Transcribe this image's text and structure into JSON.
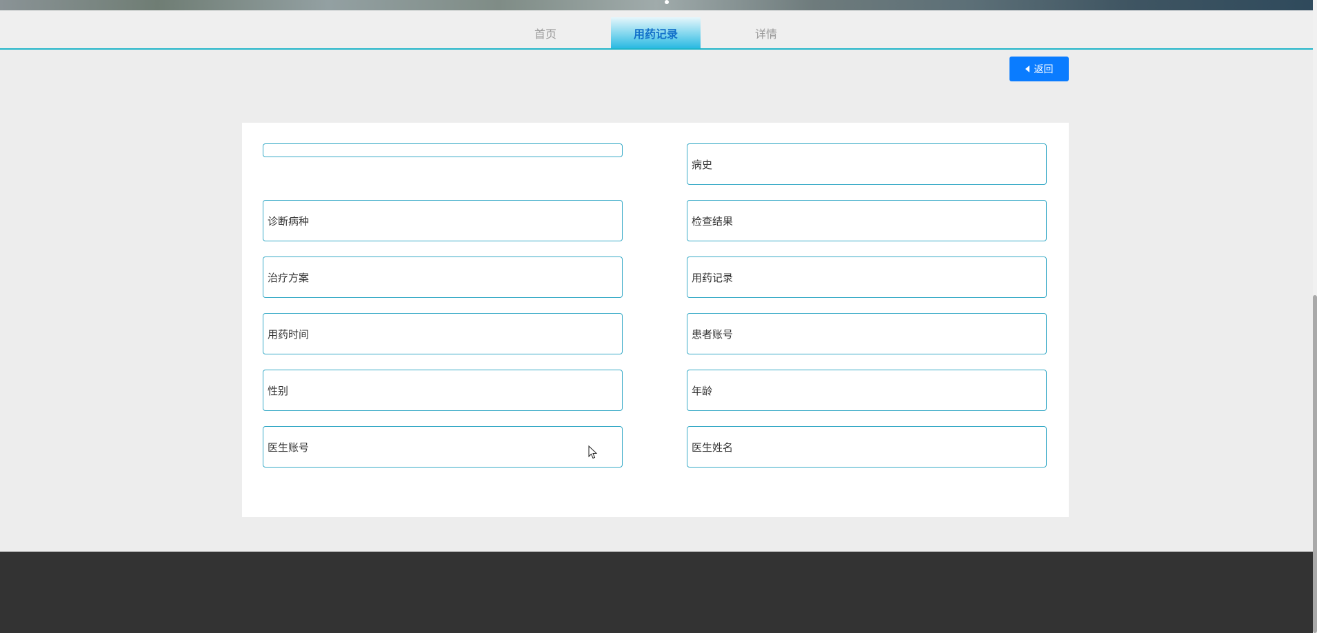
{
  "nav": {
    "tabs": [
      {
        "label": "首页",
        "active": false
      },
      {
        "label": "用药记录",
        "active": true
      },
      {
        "label": "详情",
        "active": false
      }
    ]
  },
  "back_button": {
    "label": "返回",
    "icon": "caret-left-icon"
  },
  "form": {
    "fields": [
      {
        "label": ""
      },
      {
        "label": "病史"
      },
      {
        "label": "诊断病种"
      },
      {
        "label": "检查结果"
      },
      {
        "label": "治疗方案"
      },
      {
        "label": "用药记录"
      },
      {
        "label": "用药时间"
      },
      {
        "label": "患者账号"
      },
      {
        "label": "性别"
      },
      {
        "label": "年龄"
      },
      {
        "label": "医生账号"
      },
      {
        "label": "医生姓名"
      }
    ]
  },
  "colors": {
    "accent": "#1fb5c9",
    "button": "#0a7cff",
    "field_border": "#35a9c6",
    "footer": "#333333",
    "background": "#ededed"
  }
}
